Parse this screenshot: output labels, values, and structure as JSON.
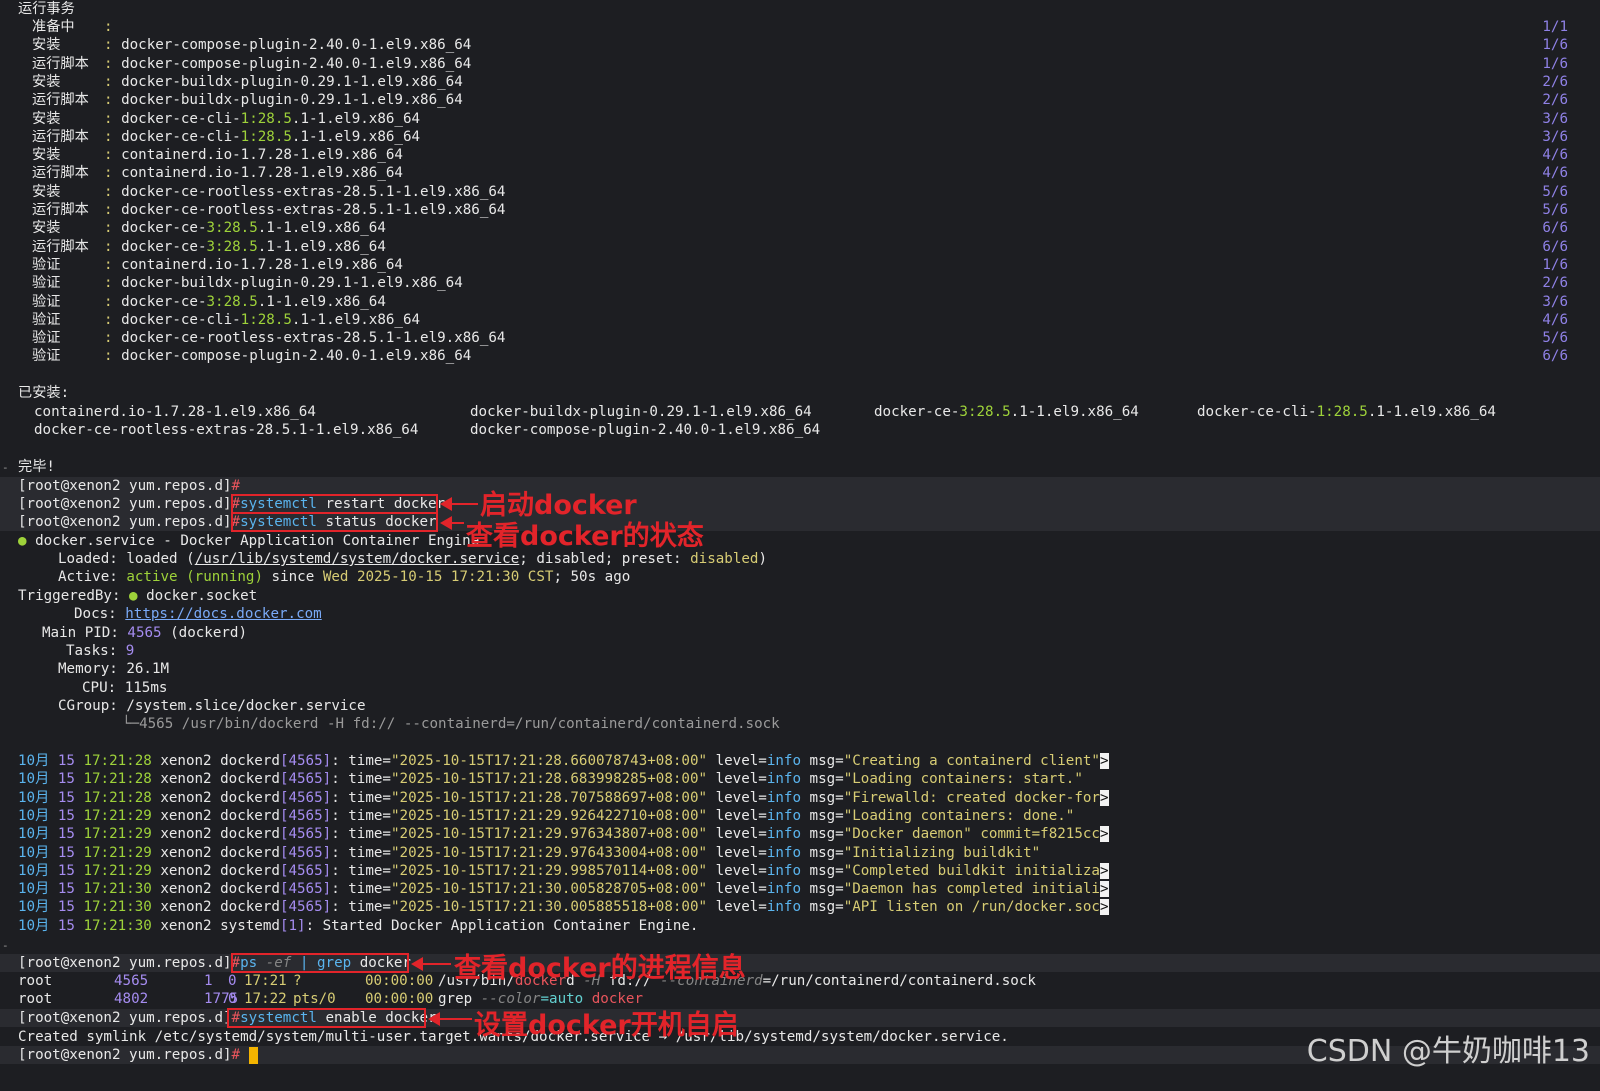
{
  "header": "运行事务",
  "transactions": [
    {
      "label": "准备中",
      "sep": ":",
      "pkg_a": "",
      "pkg_b": "",
      "pkg_c": "",
      "progress": "1/1"
    },
    {
      "label": "安装",
      "sep": ":",
      "pkg_a": "docker-compose-plugin-2.40.0-1.el9.x86_64",
      "pkg_b": "",
      "pkg_c": "",
      "progress": "1/6"
    },
    {
      "label": "运行脚本",
      "sep": ":",
      "pkg_a": "docker-compose-plugin-2.40.0-1.el9.x86_64",
      "pkg_b": "",
      "pkg_c": "",
      "progress": "1/6"
    },
    {
      "label": "安装",
      "sep": ":",
      "pkg_a": "docker-buildx-plugin-0.29.1-1.el9.x86_64",
      "pkg_b": "",
      "pkg_c": "",
      "progress": "2/6"
    },
    {
      "label": "运行脚本",
      "sep": ":",
      "pkg_a": "docker-buildx-plugin-0.29.1-1.el9.x86_64",
      "pkg_b": "",
      "pkg_c": "",
      "progress": "2/6"
    },
    {
      "label": "安装",
      "sep": ":",
      "pkg_a": "docker-ce-cli-",
      "pkg_b": "1:28.5",
      "pkg_c": ".1-1.el9.x86_64",
      "progress": "3/6"
    },
    {
      "label": "运行脚本",
      "sep": ":",
      "pkg_a": "docker-ce-cli-",
      "pkg_b": "1:28.5",
      "pkg_c": ".1-1.el9.x86_64",
      "progress": "3/6"
    },
    {
      "label": "安装",
      "sep": ":",
      "pkg_a": "containerd.io-1.7.28-1.el9.x86_64",
      "pkg_b": "",
      "pkg_c": "",
      "progress": "4/6"
    },
    {
      "label": "运行脚本",
      "sep": ":",
      "pkg_a": "containerd.io-1.7.28-1.el9.x86_64",
      "pkg_b": "",
      "pkg_c": "",
      "progress": "4/6"
    },
    {
      "label": "安装",
      "sep": ":",
      "pkg_a": "docker-ce-rootless-extras-28.5.1-1.el9.x86_64",
      "pkg_b": "",
      "pkg_c": "",
      "progress": "5/6"
    },
    {
      "label": "运行脚本",
      "sep": ":",
      "pkg_a": "docker-ce-rootless-extras-28.5.1-1.el9.x86_64",
      "pkg_b": "",
      "pkg_c": "",
      "progress": "5/6"
    },
    {
      "label": "安装",
      "sep": ":",
      "pkg_a": "docker-ce-",
      "pkg_b": "3:28.5",
      "pkg_c": ".1-1.el9.x86_64",
      "progress": "6/6"
    },
    {
      "label": "运行脚本",
      "sep": ":",
      "pkg_a": "docker-ce-",
      "pkg_b": "3:28.5",
      "pkg_c": ".1-1.el9.x86_64",
      "progress": "6/6"
    },
    {
      "label": "验证",
      "sep": ":",
      "pkg_a": "containerd.io-1.7.28-1.el9.x86_64",
      "pkg_b": "",
      "pkg_c": "",
      "progress": "1/6"
    },
    {
      "label": "验证",
      "sep": ":",
      "pkg_a": "docker-buildx-plugin-0.29.1-1.el9.x86_64",
      "pkg_b": "",
      "pkg_c": "",
      "progress": "2/6"
    },
    {
      "label": "验证",
      "sep": ":",
      "pkg_a": "docker-ce-",
      "pkg_b": "3:28.5",
      "pkg_c": ".1-1.el9.x86_64",
      "progress": "3/6"
    },
    {
      "label": "验证",
      "sep": ":",
      "pkg_a": "docker-ce-cli-",
      "pkg_b": "1:28.5",
      "pkg_c": ".1-1.el9.x86_64",
      "progress": "4/6"
    },
    {
      "label": "验证",
      "sep": ":",
      "pkg_a": "docker-ce-rootless-extras-28.5.1-1.el9.x86_64",
      "pkg_b": "",
      "pkg_c": "",
      "progress": "5/6"
    },
    {
      "label": "验证",
      "sep": ":",
      "pkg_a": "docker-compose-plugin-2.40.0-1.el9.x86_64",
      "pkg_b": "",
      "pkg_c": "",
      "progress": "6/6"
    }
  ],
  "installed": {
    "title": "已安装:",
    "row1": [
      "containerd.io-1.7.28-1.el9.x86_64",
      "docker-buildx-plugin-0.29.1-1.el9.x86_64",
      "docker-ce-",
      "3:28.5",
      ".1-1.el9.x86_64",
      "docker-ce-cli-",
      "1:28.5",
      ".1-1.el9.x86_64"
    ],
    "row2": [
      "docker-ce-rootless-extras-28.5.1-1.el9.x86_64",
      "docker-compose-plugin-2.40.0-1.el9.x86_64"
    ]
  },
  "complete": "完毕!",
  "prompt": "[root@xenon2 yum.repos.d]",
  "hash": "#",
  "cmd_restart": {
    "a": "systemctl",
    "b": " restart docker"
  },
  "cmd_status": {
    "a": "systemctl",
    "b": " status docker"
  },
  "status": {
    "bullet": "●",
    "unit": "docker.service",
    "dash": " - ",
    "desc": "Docker Application Container Engine",
    "loaded_label": "Loaded:",
    "loaded_a": "loaded (",
    "loaded_path": "/usr/lib/systemd/system/docker.service",
    "loaded_b": "; disabled; preset: ",
    "loaded_c": "disabled",
    "loaded_d": ")",
    "active_label": "Active:",
    "active_a": "active (running)",
    "active_b": " since ",
    "active_c": "Wed 2025-10-15 17:21:30 CST",
    "active_d": "; 50s ago",
    "triggered_label": "TriggeredBy:",
    "triggered_val": "docker.socket",
    "docs_label": "Docs:",
    "docs_val": "https://docs.docker.com",
    "pid_label": "Main PID:",
    "pid_num": "4565",
    "pid_name": " (dockerd)",
    "tasks_label": "Tasks:",
    "tasks_val": "9",
    "memory_label": "Memory:",
    "memory_val": "26.1M",
    "cpu_label": "CPU:",
    "cpu_val": "115ms",
    "cgroup_label": "CGroup:",
    "cgroup_val": "/system.slice/docker.service",
    "cgroup_tree": "└─",
    "cgroup_proc": "4565 /usr/bin/dockerd -H fd:// --containerd=/run/containerd/containerd.sock"
  },
  "logs": [
    {
      "month": "10月",
      "day": "15",
      "time": "17:21:28",
      "host": "xenon2",
      "proc": "dockerd",
      "pid": "4565",
      "ts": "2025-10-15T17:21:28.660078743+08:00",
      "msg": "Creating a containerd client\"",
      "trunc": true
    },
    {
      "month": "10月",
      "day": "15",
      "time": "17:21:28",
      "host": "xenon2",
      "proc": "dockerd",
      "pid": "4565",
      "ts": "2025-10-15T17:21:28.683998285+08:00",
      "msg": "Loading containers: start.\"",
      "trunc": false
    },
    {
      "month": "10月",
      "day": "15",
      "time": "17:21:28",
      "host": "xenon2",
      "proc": "dockerd",
      "pid": "4565",
      "ts": "2025-10-15T17:21:28.707588697+08:00",
      "msg": "Firewalld: created docker-for",
      "trunc": true
    },
    {
      "month": "10月",
      "day": "15",
      "time": "17:21:29",
      "host": "xenon2",
      "proc": "dockerd",
      "pid": "4565",
      "ts": "2025-10-15T17:21:29.926422710+08:00",
      "msg": "Loading containers: done.\"",
      "trunc": false
    },
    {
      "month": "10月",
      "day": "15",
      "time": "17:21:29",
      "host": "xenon2",
      "proc": "dockerd",
      "pid": "4565",
      "ts": "2025-10-15T17:21:29.976343807+08:00",
      "msg": "Docker daemon\" commit=f8215cc",
      "trunc": true
    },
    {
      "month": "10月",
      "day": "15",
      "time": "17:21:29",
      "host": "xenon2",
      "proc": "dockerd",
      "pid": "4565",
      "ts": "2025-10-15T17:21:29.976433004+08:00",
      "msg": "Initializing buildkit\"",
      "trunc": false
    },
    {
      "month": "10月",
      "day": "15",
      "time": "17:21:29",
      "host": "xenon2",
      "proc": "dockerd",
      "pid": "4565",
      "ts": "2025-10-15T17:21:29.998570114+08:00",
      "msg": "Completed buildkit initializa",
      "trunc": true
    },
    {
      "month": "10月",
      "day": "15",
      "time": "17:21:30",
      "host": "xenon2",
      "proc": "dockerd",
      "pid": "4565",
      "ts": "2025-10-15T17:21:30.005828705+08:00",
      "msg": "Daemon has completed initiali",
      "trunc": true
    },
    {
      "month": "10月",
      "day": "15",
      "time": "17:21:30",
      "host": "xenon2",
      "proc": "dockerd",
      "pid": "4565",
      "ts": "2025-10-15T17:21:30.005885518+08:00",
      "msg": "API listen on /run/docker.soc",
      "trunc": true
    }
  ],
  "log_last": {
    "month": "10月",
    "day": "15",
    "time": "17:21:30",
    "host": "xenon2",
    "proc": "systemd",
    "pid": "1",
    "msg": "Started Docker Application Container Engine."
  },
  "log_keys": {
    "time": "time=",
    "level": "level=",
    "level_val": "info",
    "msg": "msg=\"",
    "trunc_mark": ">"
  },
  "cmd_ps": {
    "a": "ps",
    "b": " -ef",
    "c": " | ",
    "d": "grep",
    "e": " docker"
  },
  "ps_rows": [
    {
      "user": "root",
      "pid": "4565",
      "ppid": "1",
      "c": "0",
      "stime": "17:21",
      "tty": "?",
      "time": "00:00:00",
      "cmd_a": "/usr/bin/",
      "cmd_b": "docker",
      "cmd_c": "d",
      "cmd_d": " -H",
      "cmd_e": " fd://",
      "cmd_f": " --containerd",
      "cmd_g": "=/run/containerd/containerd.sock"
    },
    {
      "user": "root",
      "pid": "4802",
      "ppid": "1775",
      "c": "0",
      "stime": "17:22",
      "tty": "pts/0",
      "time": "00:00:00",
      "cmd_a": "grep ",
      "cmd_b": "--color",
      "cmd_c": "=auto ",
      "cmd_d": "docker",
      "cmd_e": "",
      "cmd_f": "",
      "cmd_g": ""
    }
  ],
  "cmd_enable": {
    "a": "systemctl",
    "b": " enable docker"
  },
  "symlink": "Created symlink /etc/systemd/system/multi-user.target.wants/docker.service → /usr/lib/systemd/system/docker.service.",
  "annotations": {
    "restart": "启动docker",
    "status": "查看docker的状态",
    "ps": "查看docker的进程信息",
    "enable": "设置docker开机自启"
  },
  "watermark": "CSDN @牛奶咖啡13"
}
